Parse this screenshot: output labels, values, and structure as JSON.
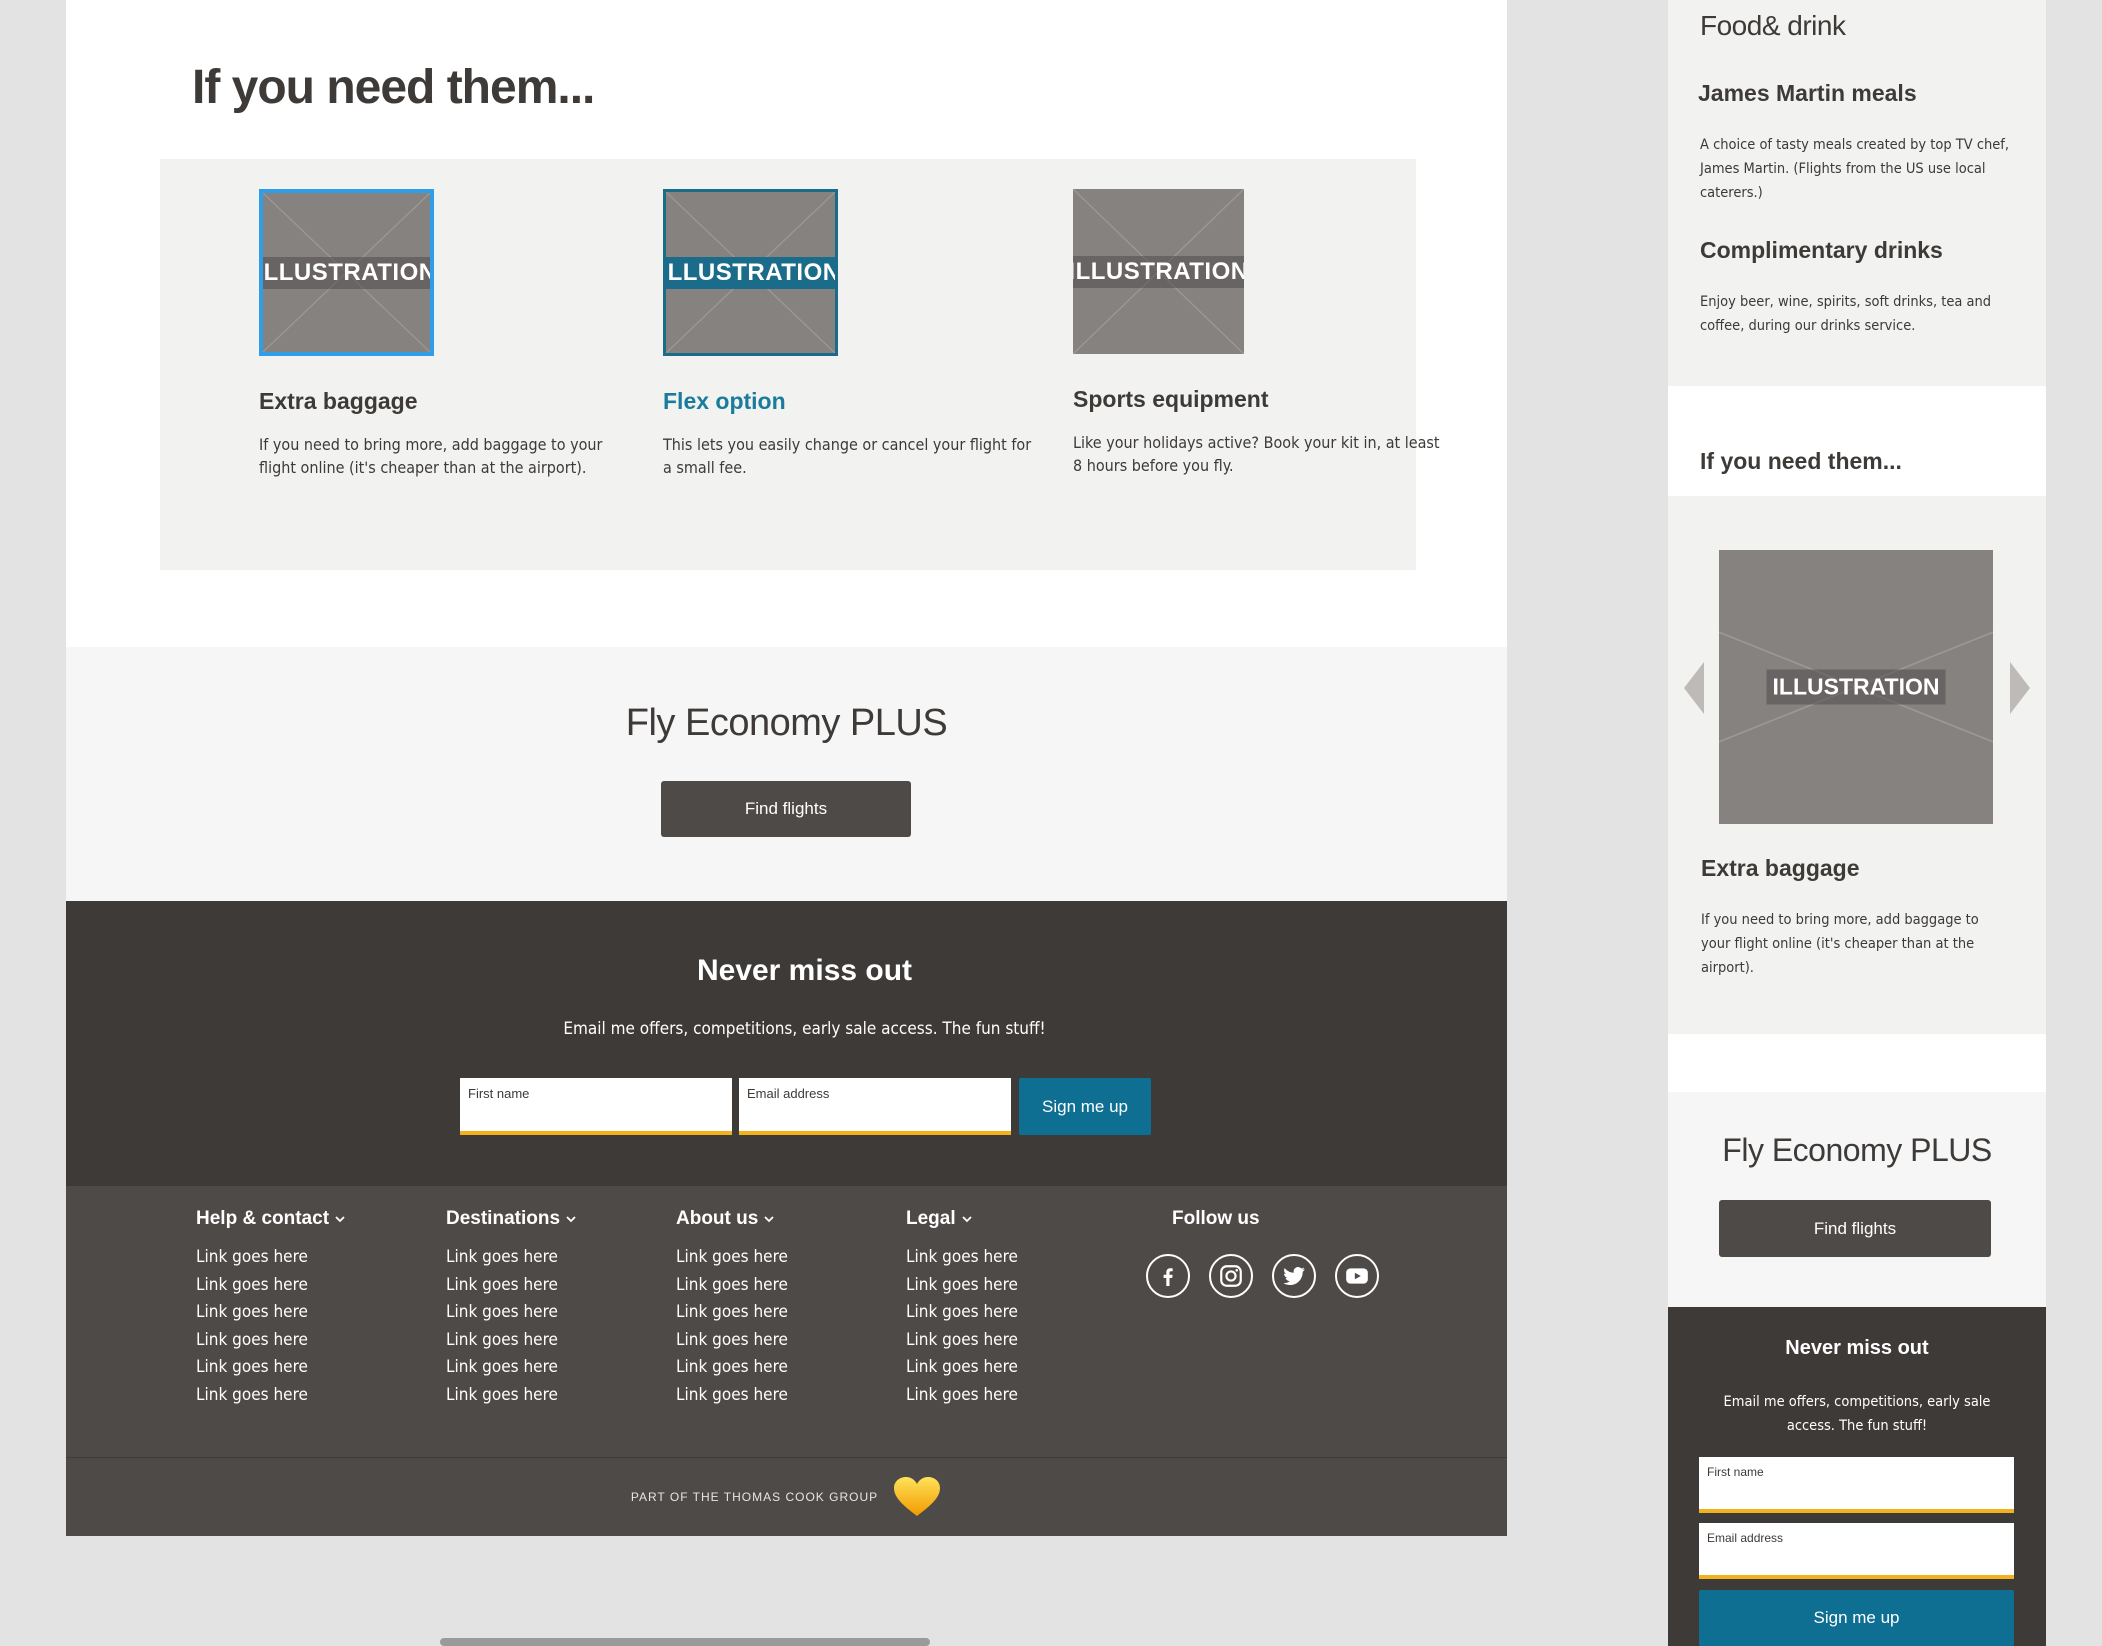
{
  "desktop": {
    "hero_title": "If you need them...",
    "cards": [
      {
        "illustration": "ILLUSTRATION",
        "title": "Extra baggage",
        "desc": "If you need to bring more, add baggage to your flight online (it's cheaper than at the airport)."
      },
      {
        "illustration": "ILLUSTRATION",
        "title": "Flex option",
        "desc": "This lets you easily change or cancel your flight for a small fee."
      },
      {
        "illustration": "ILLUSTRATION",
        "title": "Sports equipment",
        "desc": "Like your holidays active? Book your kit in, at least 8 hours before you fly."
      }
    ],
    "plus": {
      "title": "Fly Economy PLUS",
      "button": "Find flights"
    },
    "newsletter": {
      "title": "Never miss out",
      "subtitle": "Email me offers, competitions, early sale access. The fun stuff!",
      "first_name_placeholder": "First name",
      "email_placeholder": "Email address",
      "button": "Sign me up"
    },
    "footer": {
      "columns": [
        {
          "heading": "Help & contact",
          "links": [
            "Link goes here",
            "Link goes here",
            "Link goes here",
            "Link goes here",
            "Link goes here",
            "Link goes here"
          ]
        },
        {
          "heading": "Destinations",
          "links": [
            "Link goes here",
            "Link goes here",
            "Link goes here",
            "Link goes here",
            "Link goes here",
            "Link goes here"
          ]
        },
        {
          "heading": "About us",
          "links": [
            "Link goes here",
            "Link goes here",
            "Link goes here",
            "Link goes here",
            "Link goes here",
            "Link goes here"
          ]
        },
        {
          "heading": "Legal",
          "links": [
            "Link goes here",
            "Link goes here",
            "Link goes here",
            "Link goes here",
            "Link goes here",
            "Link goes here"
          ]
        }
      ],
      "follow_heading": "Follow us",
      "social_icons": [
        "facebook-icon",
        "instagram-icon",
        "twitter-icon",
        "youtube-icon"
      ],
      "group_text": "PART OF THE THOMAS COOK GROUP",
      "heart_color": "#f5b800"
    }
  },
  "mobile": {
    "food_title": "Food& drink",
    "items": [
      {
        "title": "James Martin meals",
        "desc": "A choice of tasty meals created by top TV chef, James Martin. (Flights from the US use local caterers.)"
      },
      {
        "title": "Complimentary drinks",
        "desc": "Enjoy beer, wine, spirits, soft drinks, tea and coffee, during our drinks service."
      }
    ],
    "ifneed_title": "If you need them...",
    "carousel": {
      "illustration": "ILLUSTRATION",
      "title": "Extra baggage",
      "desc": "If you need to bring more, add baggage to your flight online (it's cheaper than at the airport)."
    },
    "plus": {
      "title": "Fly Economy PLUS",
      "button": "Find flights"
    },
    "newsletter": {
      "title": "Never miss out",
      "subtitle": "Email me offers, competitions, early sale access. The fun stuff!",
      "first_name_placeholder": "First name",
      "email_placeholder": "Email address",
      "button": "Sign me up"
    }
  },
  "colors": {
    "teal": "#0e6f92",
    "selected_blue": "#2f9ee6",
    "accent_yellow": "#f2b21b",
    "dark": "#3e3a38"
  }
}
